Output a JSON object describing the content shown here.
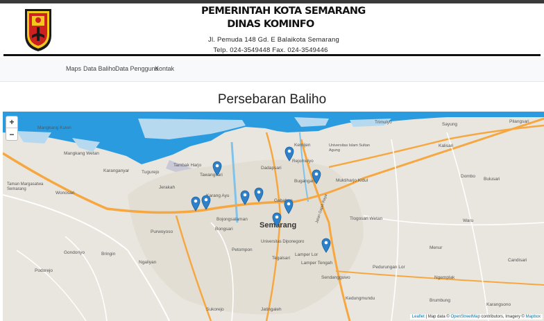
{
  "header": {
    "title_line1": "PEMERINTAH KOTA SEMARANG",
    "title_line2": "DINAS KOMINFO",
    "address": "Jl. Pemuda 148 Gd. E Balaikota Semarang",
    "phone": "Telp. 024-3549448 Fax. 024-3549446"
  },
  "nav": {
    "items": [
      "Maps",
      "Data Baliho",
      "Data Pengguna",
      "Kontak"
    ]
  },
  "main": {
    "title": "Persebaran Baliho"
  },
  "map": {
    "zoom_in": "+",
    "zoom_out": "−",
    "attribution": {
      "leaflet": "Leaflet",
      "map_data": "| Map data ©",
      "osm": "OpenStreetMap",
      "contrib": "contributors, Imagery ©",
      "mapbox": "Mapbox"
    },
    "city_label": "Semarang",
    "labels": {
      "mangkang_kulon": "Mangkang Kulon",
      "mangkang_wetan": "Mangkang Wetan",
      "karanganyar": "Karanganyar",
      "tugurejo": "Tugurejo",
      "tambak_harjo": "Tambak Harjo",
      "tawangsari": "Tawangsari",
      "jerakah": "Jerakah",
      "karang_ayu": "Karang Ayu",
      "taman_margasatwa": "Taman Margasatwa Semarang",
      "wonosari": "Wonosari",
      "purwoyoso": "Purwoyoso",
      "gondoriyo": "Gondoriyo",
      "bringin": "Bringin",
      "ngaliyan": "Ngaliyan",
      "podorejo": "Podorejo",
      "bojongsalaman": "Bojongsalaman",
      "bongsari": "Bongsari",
      "petompon": "Petompon",
      "dadapsari": "Dadapsari",
      "gabahan": "Gabahan",
      "kemijen": "Kemijen",
      "rejomulyo": "Rejomulyo",
      "bugangan": "Bugangan",
      "muktiharjo_kidul": "Muktiharjo Kidul",
      "tlogosari_wetan": "Tlogosari Wetan",
      "universitas_diponegoro": "Universitas Diponegoro",
      "tegalsari": "Tegalsari",
      "lamper_lor": "Lamper Lor",
      "lamper_tengah": "Lamper Tengah",
      "sendangguwo": "Sendangguwo",
      "kedungmundu": "Kedungmundu",
      "pedurungan_lor": "Pedurungan Lor",
      "sukorejo": "Sukorejo",
      "jatingaleh": "Jatingaleh",
      "trimulyo": "Trimulyo",
      "sayung": "Sayung",
      "pilangsari": "Pilangsari",
      "kalisari": "Kalisari",
      "dombo": "Dombo",
      "bulusari": "Bulusari",
      "waru": "Waru",
      "menur": "Menur",
      "candisari": "Candisari",
      "ngemplak": "Ngemplak",
      "brumbung": "Brumbung",
      "karangsono": "Karangsono",
      "universitas_islam": "Universitas Islam Sultan Agung",
      "jalan_gajah_raya": "Jalan Gajah Raya"
    },
    "markers_count": 12
  },
  "colors": {
    "marker": "#2e81c9",
    "sea": "#2b9be0",
    "land": "#ebe7e0",
    "road_major": "#f6a740",
    "road_minor": "#ffffff",
    "header_rule": "#111111"
  }
}
